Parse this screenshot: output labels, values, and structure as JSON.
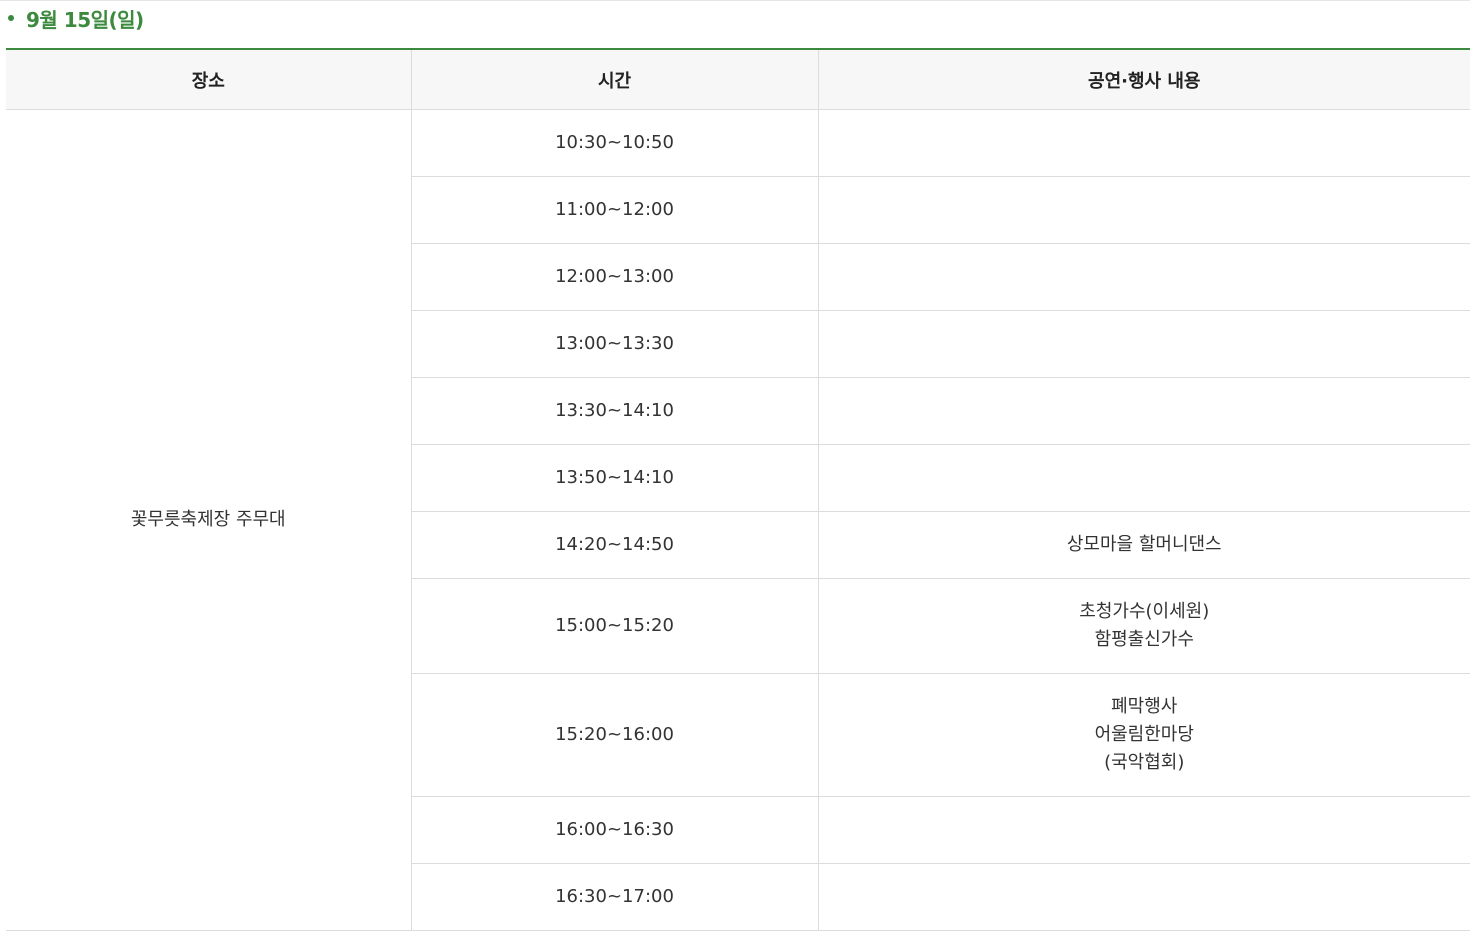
{
  "section": {
    "title": "9월 15일(일)"
  },
  "table": {
    "headers": [
      "장소",
      "시간",
      "공연·행사 내용"
    ],
    "venue": "꽃무릇축제장 주무대",
    "rows": [
      {
        "time": "10:30~10:50",
        "content": []
      },
      {
        "time": "11:00~12:00",
        "content": []
      },
      {
        "time": "12:00~13:00",
        "content": []
      },
      {
        "time": "13:00~13:30",
        "content": []
      },
      {
        "time": "13:30~14:10",
        "content": []
      },
      {
        "time": "13:50~14:10",
        "content": []
      },
      {
        "time": "14:20~14:50",
        "content": [
          "상모마을 할머니댄스"
        ]
      },
      {
        "time": "15:00~15:20",
        "content": [
          "초청가수(이세원)",
          "함평출신가수"
        ]
      },
      {
        "time": "15:20~16:00",
        "content": [
          "폐막행사",
          "어울림한마당",
          "(국악협회)"
        ]
      },
      {
        "time": "16:00~16:30",
        "content": []
      },
      {
        "time": "16:30~17:00",
        "content": []
      }
    ]
  }
}
